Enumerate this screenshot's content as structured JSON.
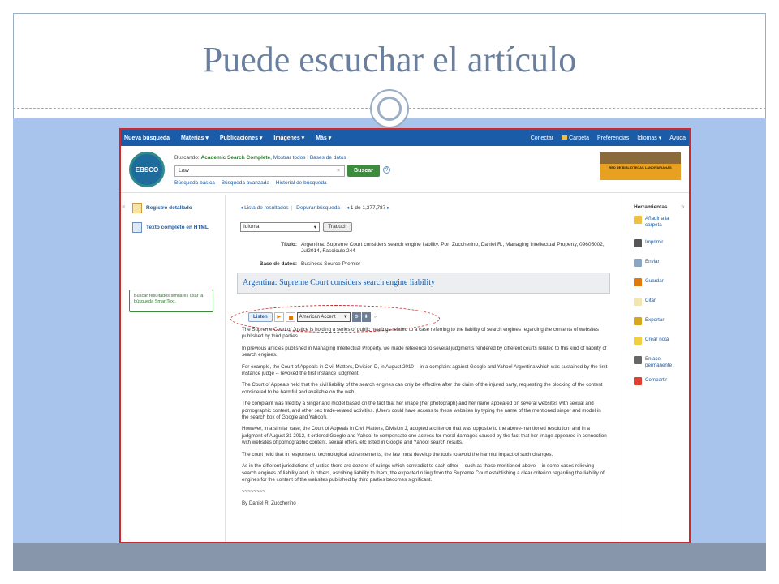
{
  "slide": {
    "title": "Puede escuchar el artículo"
  },
  "colors": {
    "title": "#6a7f9d",
    "band": "#a8c4ec",
    "bottom_bar": "#8796aa",
    "ebsco_nav": "#1b5ca8",
    "search_button": "#3d8b3d",
    "highlight_outline": "#cc2a2a"
  },
  "topnav": {
    "left": [
      "Nueva búsqueda",
      "Materias ▾",
      "Publicaciones ▾",
      "Imágenes ▾",
      "Más ▾"
    ],
    "right": [
      "Conectar",
      "Carpeta",
      "Preferencias",
      "Idiomas ▾",
      "Ayuda"
    ]
  },
  "search": {
    "searching_label": "Buscando:",
    "database_name": "Academic Search Complete",
    "show_all": "Mostrar todos",
    "databases_link": "Bases de datos",
    "query": "Law",
    "clear_glyph": "×",
    "button_label": "Buscar",
    "help_glyph": "?",
    "links": [
      "Búsqueda básica",
      "Búsqueda avanzada",
      "Historial de búsqueda"
    ]
  },
  "branding": {
    "ebsco_logo_text": "EBSCO",
    "library_logo_text": "RED DE BIBLIOTECAS LANDIVARIANAS"
  },
  "left_panel": {
    "collapse_glyph": "«",
    "detailed_record": "Registro detallado",
    "full_text_html": "Texto completo en HTML",
    "similar_results": "Buscar resultados similares usar la búsqueda SmartText."
  },
  "result_nav": {
    "back_to_results": "◂ Lista de resultados",
    "refine_search": "Depurar búsqueda",
    "prev_glyph": "◂",
    "position": "1 de 1,377,787",
    "next_glyph": "▸"
  },
  "translate": {
    "language_select": "Idioma",
    "button_label": "Traducir"
  },
  "record": {
    "title_label": "Título:",
    "title_value": "Argentina: Supreme Court considers search engine liability. Por: Zuccherino, Daniel R., Managing Intellectual Property, 09605002, Jul2014, Fascículo 244",
    "database_label": "Base de datos:",
    "database_value": "Business Source Premier",
    "article_title": "Argentina: Supreme Court considers search engine liability"
  },
  "listen_bar": {
    "listen_label": "Listen",
    "play_glyph": "▶",
    "accent": "American Accent",
    "accent_arrow": "▼",
    "settings_glyph": "⚙",
    "download_glyph": "⬇",
    "more_glyph": "»"
  },
  "article": {
    "paragraphs": [
      "The Supreme Court of Justice is holding a series of public hearings related to a case referring to the liability of search engines regarding the contents of websites published by third parties.",
      "In previous articles published in Managing Intellectual Property, we made reference to several judgments rendered by different courts related to this kind of liability of search engines.",
      "For example, the Court of Appeals in Civil Matters, Division D, in August 2010 -- in a complaint against Google and Yahoo! Argentina which was sustained by the first instance judge -- revoked the first instance judgment.",
      "The Court of Appeals held that the civil liability of the search engines can only be effective after the claim of the injured party, requesting the blocking of the content considered to be harmful and available on the web.",
      "The complaint was filed by a singer and model based on the fact that her image (her photograph) and her name appeared on several websites with sexual and pornographic content, and other sex trade-related activities. (Users could have access to these websites by typing the name of the mentioned singer and model in the search box of Google and Yahoo!).",
      "However, in a similar case, the Court of Appeals in Civil Matters, Division J, adopted a criterion that was opposite to the above-mentioned resolution, and in a judgment of August 31 2012, it ordered Google and Yahoo! to compensate one actress for moral damages caused by the fact that her image appeared in connection with websites of pornographic content, sexual offers, etc listed in Google and Yahoo! search results.",
      "The court held that in response to technological advancements, the law must develop the tools to avoid the harmful impact of such changes.",
      "As in the different jurisdictions of justice there are dozens of rulings which contradict to each other -- such as those mentioned above -- in some cases relieving search engines of liability and, in others, ascribing liability to them, the expected ruling from the Supreme Court establishing a clear criterion regarding the liability of engines for the content of the websites published by third parties becomes significant.",
      "~~~~~~~~",
      "By Daniel R. Zuccherino"
    ]
  },
  "tools": {
    "expand_glyph": "»",
    "title": "Herramientas",
    "items": [
      {
        "label": "Añadir a la carpeta",
        "icon": "folder-icon",
        "color": "#f0c040"
      },
      {
        "label": "Imprimir",
        "icon": "printer-icon",
        "color": "#555555"
      },
      {
        "label": "Enviar",
        "icon": "email-icon",
        "color": "#8aa6c4"
      },
      {
        "label": "Guardar",
        "icon": "save-icon",
        "color": "#e07a10"
      },
      {
        "label": "Citar",
        "icon": "cite-icon",
        "color": "#f2e6b0"
      },
      {
        "label": "Exportar",
        "icon": "export-icon",
        "color": "#d9a520"
      },
      {
        "label": "Crear nota",
        "icon": "note-icon",
        "color": "#f0d040"
      },
      {
        "label": "Enlace permanente",
        "icon": "permalink-icon",
        "color": "#666666"
      },
      {
        "label": "Compartir",
        "icon": "share-icon",
        "color": "#e04030"
      }
    ]
  }
}
